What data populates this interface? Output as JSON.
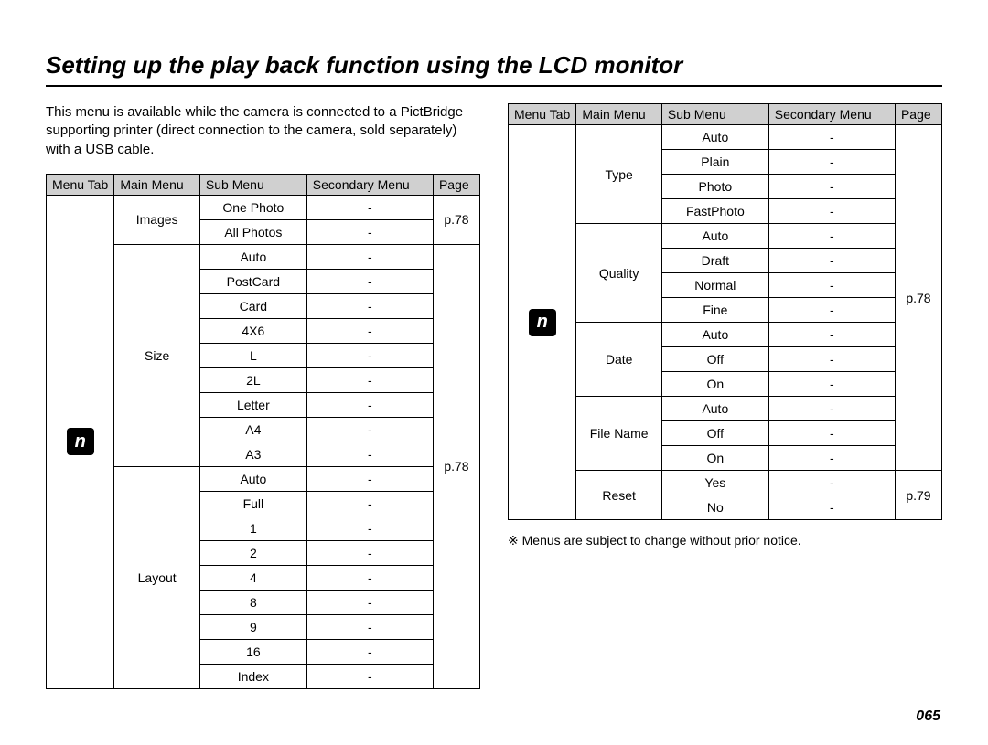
{
  "title": "Setting up the play back function using the LCD monitor",
  "intro": "This menu is available while the camera is connected to a PictBridge supporting printer (direct connection to the camera, sold separately) with a USB cable.",
  "headers": {
    "tab": "Menu Tab",
    "main": "Main Menu",
    "sub": "Sub Menu",
    "sec": "Secondary Menu",
    "page": "Page"
  },
  "tab_icon_glyph": "n",
  "left_table": {
    "groups": [
      {
        "main": "Images",
        "page": "p.78",
        "subs": [
          "One Photo",
          "All Photos"
        ]
      },
      {
        "main": "Size",
        "page_group_with_next": true,
        "subs": [
          "Auto",
          "PostCard",
          "Card",
          "4X6",
          "L",
          "2L",
          "Letter",
          "A4",
          "A3"
        ]
      },
      {
        "main": "Layout",
        "page": "p.78",
        "subs": [
          "Auto",
          "Full",
          "1",
          "2",
          "4",
          "8",
          "9",
          "16",
          "Index"
        ]
      }
    ]
  },
  "right_table": {
    "page_all": "p.78",
    "reset_page": "p.79",
    "groups": [
      {
        "main": "Type",
        "subs": [
          "Auto",
          "Plain",
          "Photo",
          "FastPhoto"
        ]
      },
      {
        "main": "Quality",
        "subs": [
          "Auto",
          "Draft",
          "Normal",
          "Fine"
        ]
      },
      {
        "main": "Date",
        "subs": [
          "Auto",
          "Off",
          "On"
        ]
      },
      {
        "main": "File Name",
        "subs": [
          "Auto",
          "Off",
          "On"
        ]
      },
      {
        "main": "Reset",
        "subs": [
          "Yes",
          "No"
        ]
      }
    ]
  },
  "note": "※  Menus are subject to change without prior notice.",
  "page_number": "065",
  "dash": "-"
}
